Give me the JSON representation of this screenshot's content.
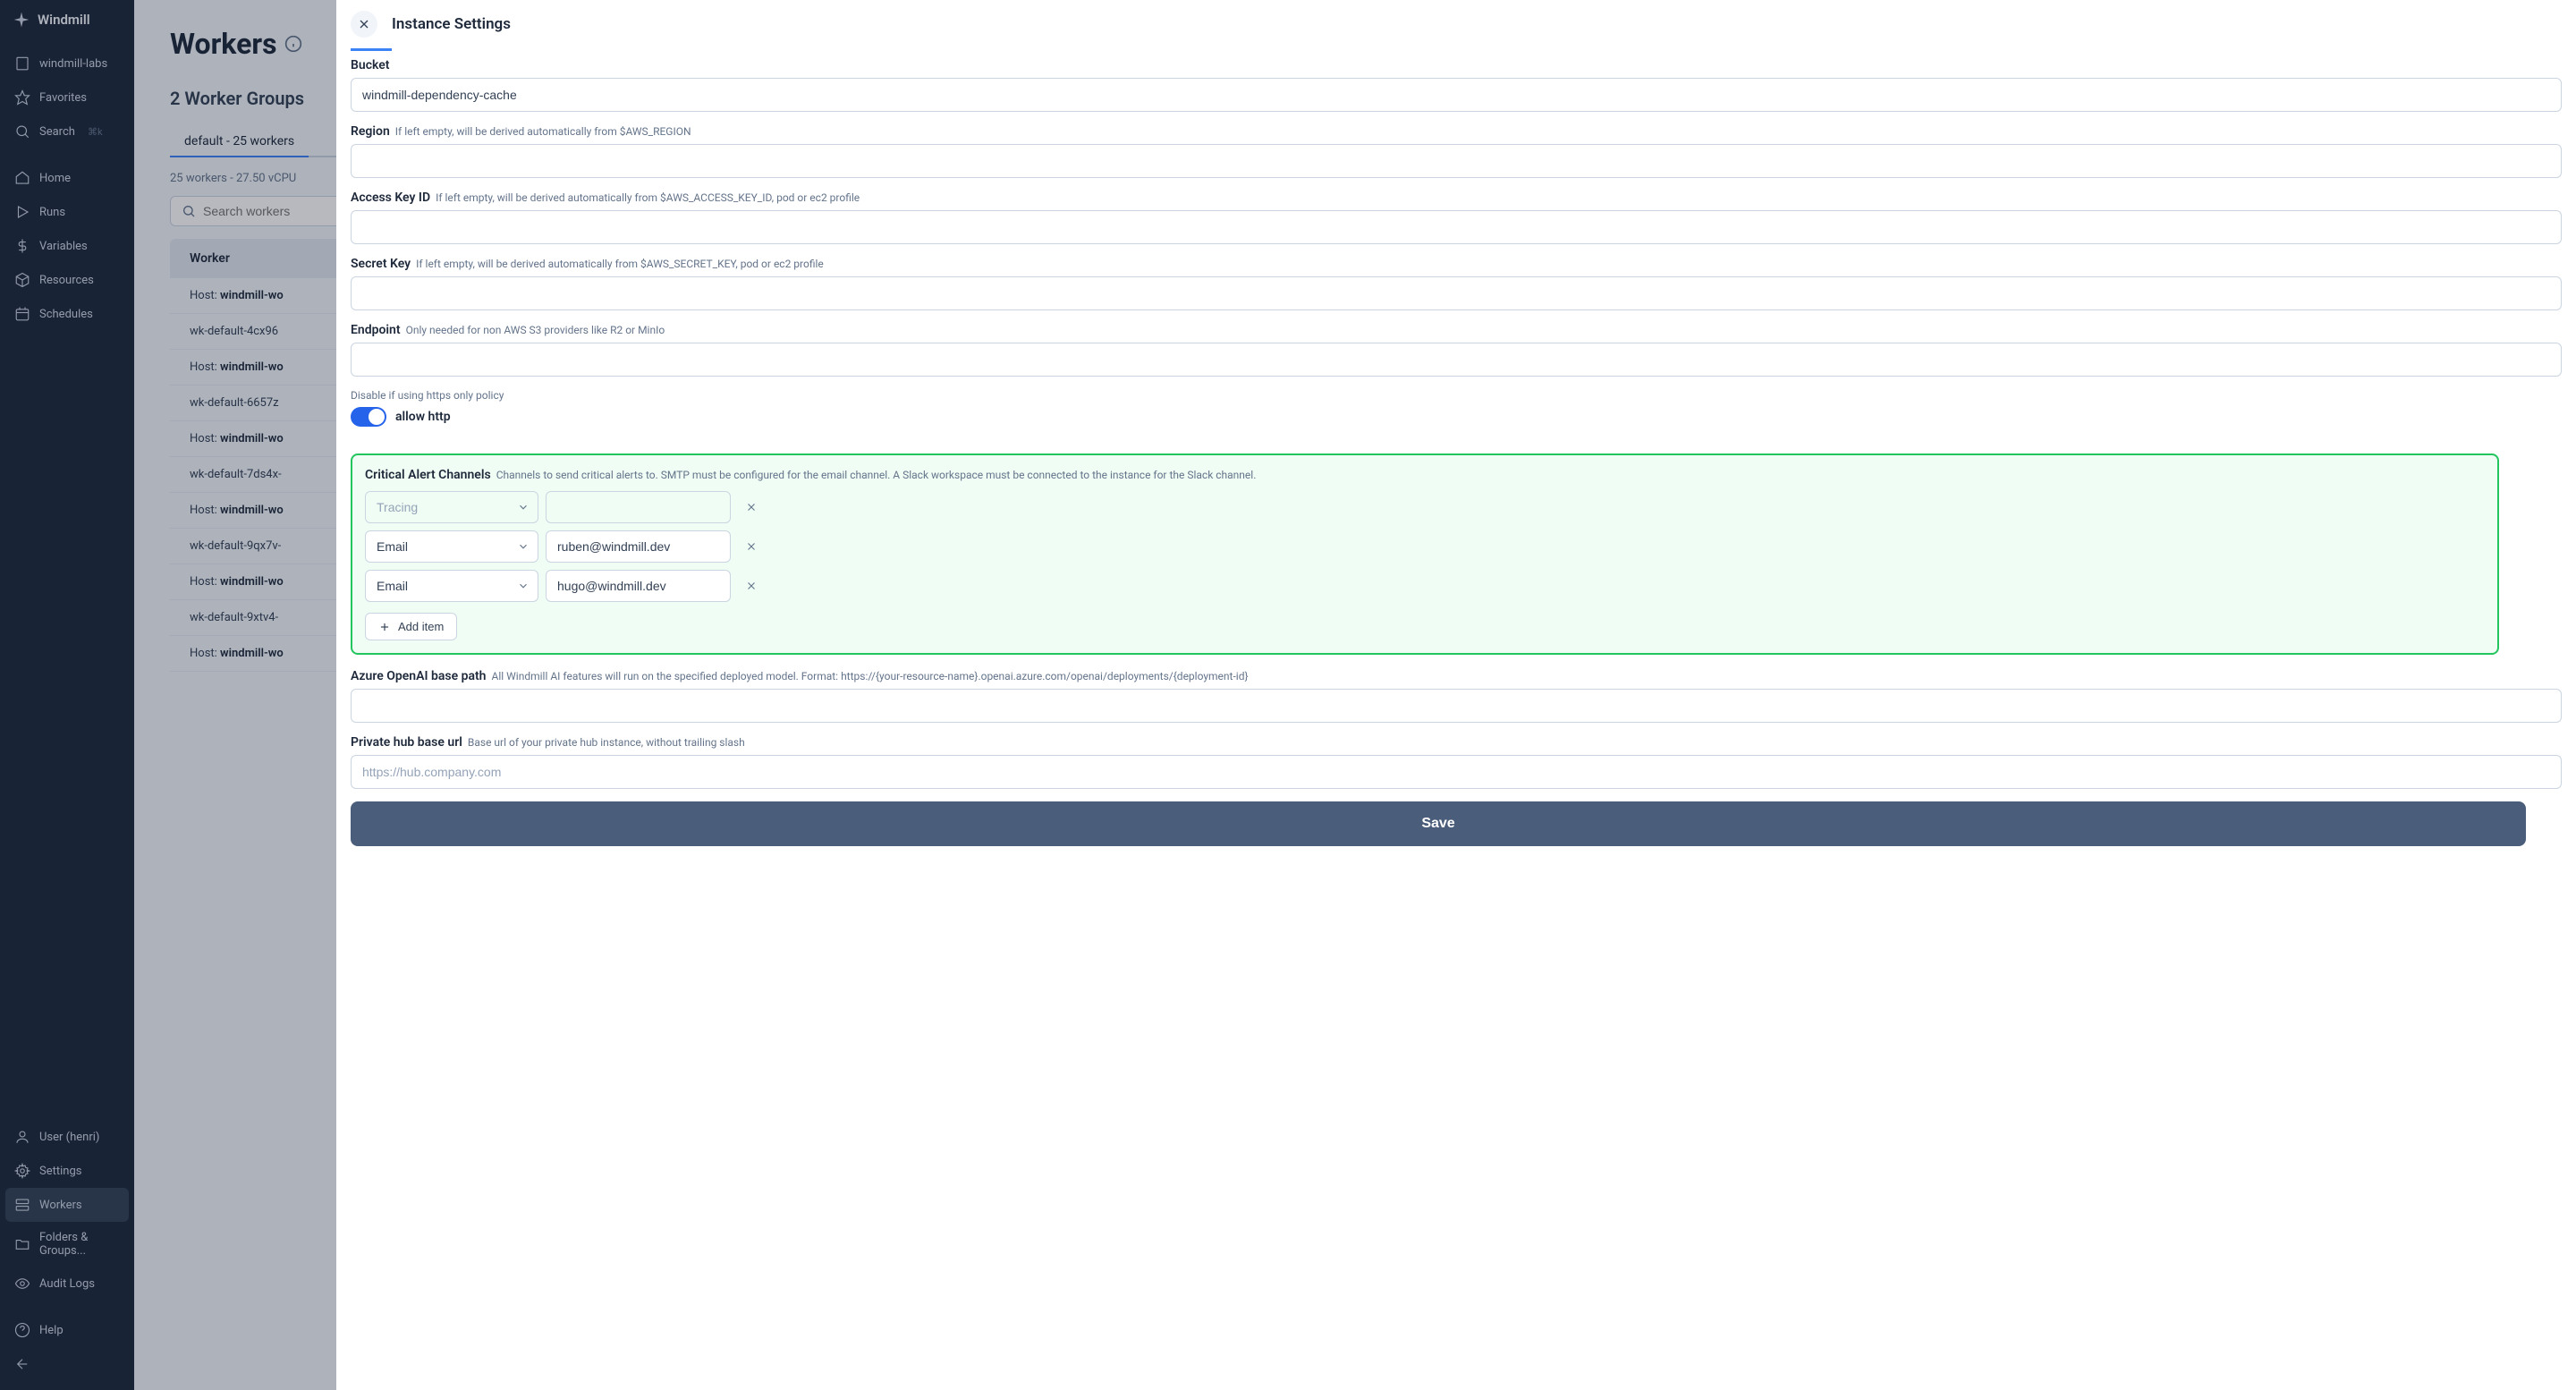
{
  "sidebar": {
    "brand": "Windmill",
    "workspace": "windmill-labs",
    "items": [
      {
        "label": "Favorites"
      },
      {
        "label": "Search",
        "shortcut": "⌘k"
      },
      {
        "label": "Home"
      },
      {
        "label": "Runs"
      },
      {
        "label": "Variables"
      },
      {
        "label": "Resources"
      },
      {
        "label": "Schedules"
      }
    ],
    "bottom": [
      {
        "label": "User (henri)"
      },
      {
        "label": "Settings"
      },
      {
        "label": "Workers"
      },
      {
        "label": "Folders & Groups..."
      },
      {
        "label": "Audit Logs"
      },
      {
        "label": "Help"
      }
    ]
  },
  "page": {
    "title": "Workers",
    "subtitle": "2 Worker Groups",
    "tab": "default - 25 workers",
    "meta": "25 workers - 27.50 vCPU",
    "search_placeholder": "Search workers",
    "table_header": "Worker",
    "rows": [
      "Host: windmill-wo",
      "wk-default-4cx96",
      "Host: windmill-wo",
      "wk-default-6657z",
      "Host: windmill-wo",
      "wk-default-7ds4x-",
      "Host: windmill-wo",
      "wk-default-9qx7v-",
      "Host: windmill-wo",
      "wk-default-9xtv4-",
      "Host: windmill-wo"
    ]
  },
  "modal": {
    "title": "Instance Settings",
    "bucket": {
      "label": "Bucket",
      "value": "windmill-dependency-cache"
    },
    "region": {
      "label": "Region",
      "hint": "If left empty, will be derived automatically from $AWS_REGION",
      "value": ""
    },
    "access_key": {
      "label": "Access Key ID",
      "hint": "If left empty, will be derived automatically from $AWS_ACCESS_KEY_ID, pod or ec2 profile",
      "value": ""
    },
    "secret_key": {
      "label": "Secret Key",
      "hint": "If left empty, will be derived automatically from $AWS_SECRET_KEY, pod or ec2 profile",
      "value": ""
    },
    "endpoint": {
      "label": "Endpoint",
      "hint": "Only needed for non AWS S3 providers like R2 or MinIo",
      "value": ""
    },
    "http_toggle": {
      "hint": "Disable if using https only policy",
      "label": "allow http"
    },
    "critical": {
      "label": "Critical Alert Channels",
      "hint": "Channels to send critical alerts to. SMTP must be configured for the email channel. A Slack workspace must be connected to the instance for the Slack channel.",
      "rows": [
        {
          "type": "Tracing",
          "value": "",
          "placeholder": true
        },
        {
          "type": "Email",
          "value": "ruben@windmill.dev"
        },
        {
          "type": "Email",
          "value": "hugo@windmill.dev"
        }
      ],
      "add_label": "Add item"
    },
    "azure": {
      "label": "Azure OpenAI base path",
      "hint": "All Windmill AI features will run on the specified deployed model. Format: https://{your-resource-name}.openai.azure.com/openai/deployments/{deployment-id}",
      "value": ""
    },
    "hub": {
      "label": "Private hub base url",
      "hint": "Base url of your private hub instance, without trailing slash",
      "placeholder": "https://hub.company.com",
      "value": ""
    },
    "save": "Save"
  }
}
